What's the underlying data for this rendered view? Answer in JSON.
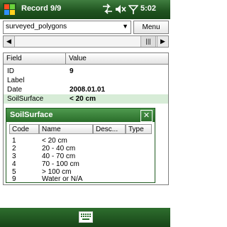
{
  "titlebar": {
    "title": "Record 9/9",
    "time": "5:02",
    "icons": [
      "windows-start-icon",
      "signal-arrows-icon",
      "volume-icon",
      "signal-strength-icon"
    ]
  },
  "layer": {
    "selected": "surveyed_polygons"
  },
  "menu_button": {
    "label": "Menu"
  },
  "list": {
    "headers": {
      "field": "Field",
      "value": "Value"
    },
    "rows": [
      {
        "field": "ID",
        "value": "9"
      },
      {
        "field": "Label",
        "value": ""
      },
      {
        "field": "Date",
        "value": "2008.01.01"
      },
      {
        "field": "SoilSurface",
        "value": "< 20 cm"
      }
    ]
  },
  "popup": {
    "title": "SoilSurface",
    "columns": [
      "Code",
      "Name",
      "Desc...",
      "Type"
    ],
    "rows": [
      {
        "code": "1",
        "name": "< 20 cm"
      },
      {
        "code": "2",
        "name": "20 - 40 cm"
      },
      {
        "code": "3",
        "name": "40 - 70 cm"
      },
      {
        "code": "4",
        "name": "70 - 100 cm"
      },
      {
        "code": "5",
        "name": "> 100 cm"
      },
      {
        "code": "9",
        "name": "Water or N/A"
      }
    ]
  },
  "colors": {
    "brand": "#2a6d2a",
    "selected_row": "#d7ecd7"
  }
}
